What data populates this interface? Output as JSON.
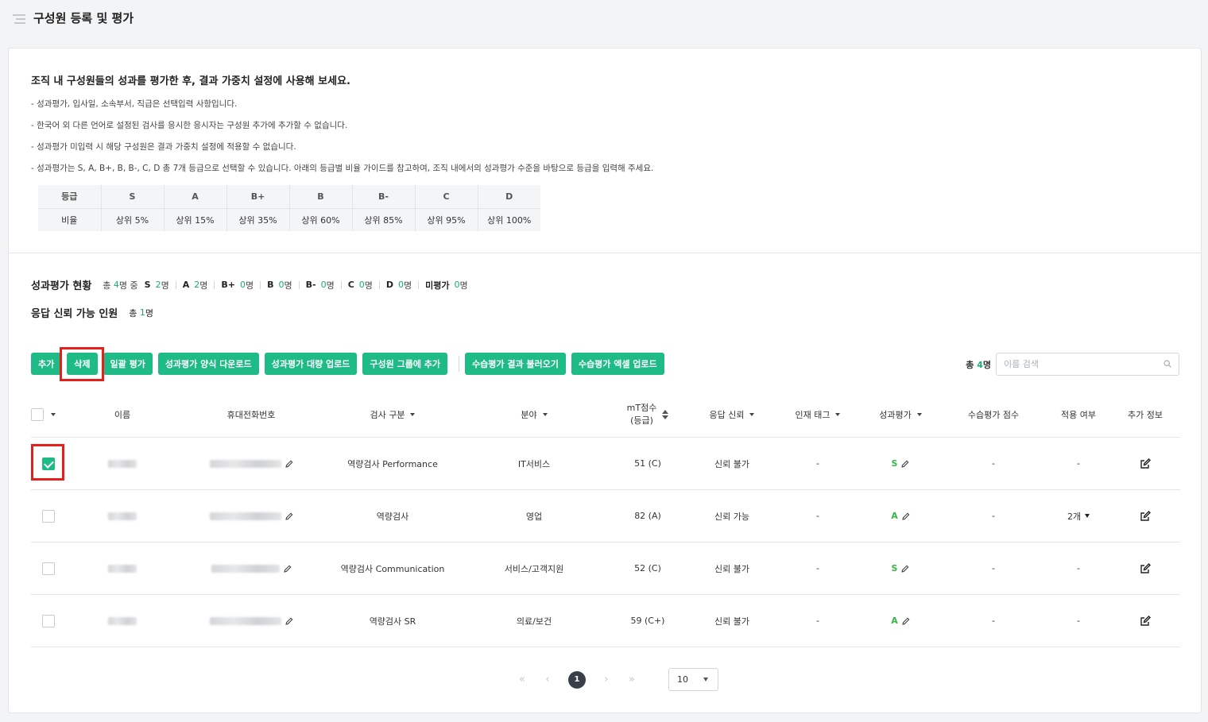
{
  "page": {
    "title": "구성원 등록 및 평가"
  },
  "guide": {
    "title": "조직 내 구성원들의 성과를 평가한 후, 결과 가중치 설정에 사용해 보세요.",
    "lines": [
      "- 성과평가, 입사일, 소속부서, 직급은 선택입력 사항입니다.",
      "- 한국어 외 다른 언어로 설정된 검사를 응시한 응시자는 구성원 추가에 추가할 수 없습니다.",
      "- 성과평가 미입력 시 해당 구성원은 결과 가중치 설정에 적용할 수 없습니다.",
      "- 성과평가는 S, A, B+, B, B-, C, D 총 7개 등급으로 선택할 수 있습니다. 아래의 등급별 비율 가이드를 참고하여, 조직 내에서의 성과평가 수준을 바탕으로 등급을 입력해 주세요."
    ]
  },
  "grade_table": {
    "header_label": "등급",
    "ratio_label": "비율",
    "grades": [
      "S",
      "A",
      "B+",
      "B",
      "B-",
      "C",
      "D"
    ],
    "ratios": [
      "상위 5%",
      "상위 15%",
      "상위 35%",
      "상위 60%",
      "상위 85%",
      "상위 95%",
      "상위 100%"
    ]
  },
  "status": {
    "label": "성과평가 현황",
    "total_prefix": "총",
    "total": "4",
    "total_suffix": "명 중",
    "unit": "명",
    "items": [
      {
        "grade": "S",
        "count": "2"
      },
      {
        "grade": "A",
        "count": "2"
      },
      {
        "grade": "B+",
        "count": "0"
      },
      {
        "grade": "B",
        "count": "0"
      },
      {
        "grade": "B-",
        "count": "0"
      },
      {
        "grade": "C",
        "count": "0"
      },
      {
        "grade": "D",
        "count": "0"
      }
    ],
    "unrated_label": "미평가",
    "unrated_count": "0"
  },
  "trust": {
    "label": "응답 신뢰 가능 인원",
    "prefix": "총",
    "count": "1",
    "unit": "명"
  },
  "toolbar": {
    "add": "추가",
    "delete": "삭제",
    "bulk_eval": "일괄 평가",
    "download_form": "성과평가 양식 다운로드",
    "bulk_upload": "성과평가 대량 업로드",
    "add_to_group": "구성원 그룹에 추가",
    "load_practice": "수습평가 결과 불러오기",
    "upload_practice_excel": "수습평가 엑셀 업로드"
  },
  "search": {
    "total_prefix": "총",
    "total": "4",
    "unit": "명",
    "placeholder": "이름 검색"
  },
  "table": {
    "headers": {
      "name": "이름",
      "phone": "휴대전화번호",
      "test_type": "검사 구분",
      "field": "분야",
      "score_line1": "mT점수",
      "score_line2": "(등급)",
      "trust": "응답 신뢰",
      "talent_tag": "인재 태그",
      "evaluation": "성과평가",
      "practice_score": "수습평가 점수",
      "applied": "적용 여부",
      "extra": "추가 정보"
    },
    "rows": [
      {
        "checked": true,
        "test_type": "역량검사 Performance",
        "field": "IT서비스",
        "score": "51 (C)",
        "trust": "신뢰 불가",
        "tag": "-",
        "grade": "S",
        "practice": "-",
        "applied": "-"
      },
      {
        "checked": false,
        "test_type": "역량검사",
        "field": "영업",
        "score": "82 (A)",
        "trust": "신뢰 가능",
        "tag": "-",
        "grade": "A",
        "practice": "-",
        "applied": "2개"
      },
      {
        "checked": false,
        "test_type": "역량검사 Communication",
        "field": "서비스/고객지원",
        "score": "52 (C)",
        "trust": "신뢰 불가",
        "tag": "-",
        "grade": "S",
        "practice": "-",
        "applied": "-"
      },
      {
        "checked": false,
        "test_type": "역량검사 SR",
        "field": "의료/보건",
        "score": "59 (C+)",
        "trust": "신뢰 불가",
        "tag": "-",
        "grade": "A",
        "practice": "-",
        "applied": "-"
      }
    ]
  },
  "pagination": {
    "first": "«",
    "prev": "‹",
    "current": "1",
    "next": "›",
    "last": "»",
    "page_size": "10"
  },
  "colors": {
    "accent": "#1ebb86",
    "highlight": "#e3201b",
    "grade_green": "#39b54a"
  }
}
